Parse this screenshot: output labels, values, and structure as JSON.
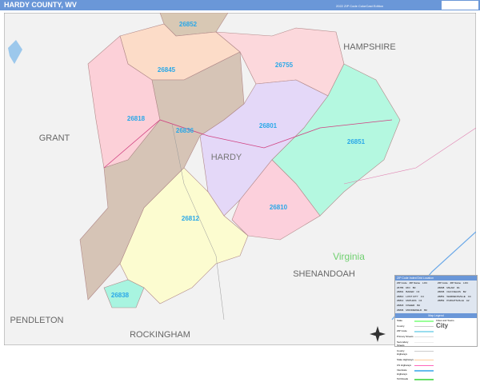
{
  "header": {
    "title": "HARDY COUNTY, WV",
    "edition": "2022 ZIP Code ColorCast Edition"
  },
  "map": {
    "county_label": "HARDY",
    "neighbors": [
      "HAMPSHIRE",
      "GRANT",
      "PENDLETON",
      "ROCKINGHAM",
      "SHENANDOAH"
    ],
    "state_label": "Virginia",
    "zips": [
      {
        "code": "26852",
        "color": "#d8c8b4"
      },
      {
        "code": "26845",
        "color": "#fcdcc8"
      },
      {
        "code": "26755",
        "color": "#fcd8dc"
      },
      {
        "code": "26818",
        "color": "#fcd0d8"
      },
      {
        "code": "26836",
        "color": "#d6c4b6"
      },
      {
        "code": "26801",
        "color": "#e4d8f8"
      },
      {
        "code": "26851",
        "color": "#b4f8e0"
      },
      {
        "code": "26810",
        "color": "#fcd0dc"
      },
      {
        "code": "26812",
        "color": "#fcfcd0"
      },
      {
        "code": "26838",
        "color": "#a8f4e0"
      }
    ]
  },
  "legend": {
    "index_title": "ZIP Code Index/Grid Location",
    "columns": [
      "ZIP Code",
      "ZIP Name",
      "LOC"
    ],
    "left": [
      {
        "zip": "26755",
        "name": "RIO",
        "loc": "B3"
      },
      {
        "zip": "26801",
        "name": "BAKER",
        "loc": "C3"
      },
      {
        "zip": "26810",
        "name": "LOST CITY",
        "loc": "C4"
      },
      {
        "zip": "26812",
        "name": "MATHIAS",
        "loc": "C4"
      },
      {
        "zip": "26818",
        "name": "FISHER",
        "loc": "B2"
      },
      {
        "zip": "26836",
        "name": "MOOREFIELD",
        "loc": "B2"
      }
    ],
    "right": [
      {
        "zip": "26838",
        "name": "MILAM",
        "loc": "D1"
      },
      {
        "zip": "26845",
        "name": "OLD FIELDS",
        "loc": "B2"
      },
      {
        "zip": "26851",
        "name": "WARDENSVILLE",
        "loc": "C4"
      },
      {
        "zip": "26852",
        "name": "PURGITSVILLE",
        "loc": "A2"
      }
    ],
    "key_title": "Map Legend",
    "key": [
      "State",
      "County",
      "ZIP Code",
      "Primary Streets",
      "Secondary Streets",
      "County Highways",
      "State Highways",
      "US Highways",
      "Interstate Highways",
      "Toll Roads"
    ],
    "cities_title": "Cities and Towns",
    "city_sample": "City"
  }
}
